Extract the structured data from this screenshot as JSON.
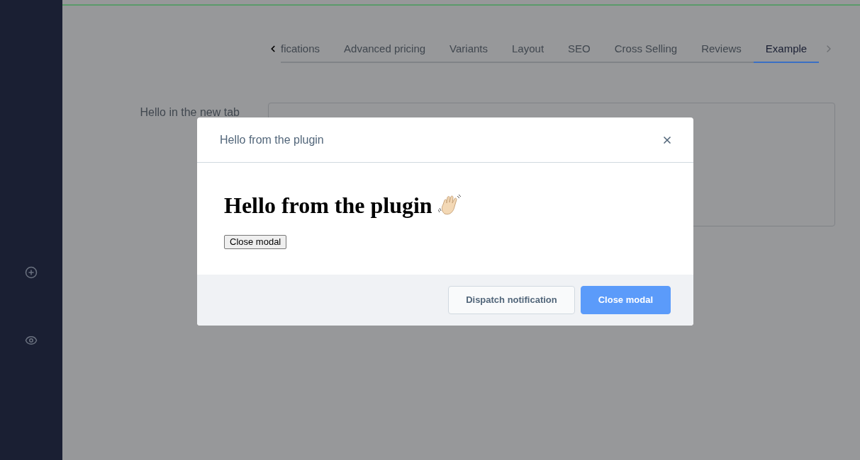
{
  "tabs": [
    {
      "label": "fications",
      "selected": false
    },
    {
      "label": "Advanced pricing",
      "selected": false
    },
    {
      "label": "Variants",
      "selected": false
    },
    {
      "label": "Layout",
      "selected": false
    },
    {
      "label": "SEO",
      "selected": false
    },
    {
      "label": "Cross Selling",
      "selected": false
    },
    {
      "label": "Reviews",
      "selected": false
    },
    {
      "label": "Example",
      "selected": true
    }
  ],
  "field": {
    "label": "Hello in the new tab"
  },
  "modal": {
    "title": "Hello from the plugin",
    "heading": "Hello from the plugin",
    "inner_button": "Close modal",
    "footer_buttons": [
      {
        "label": "Dispatch notification",
        "kind": "secondary"
      },
      {
        "label": "Close modal",
        "kind": "primary"
      }
    ]
  }
}
